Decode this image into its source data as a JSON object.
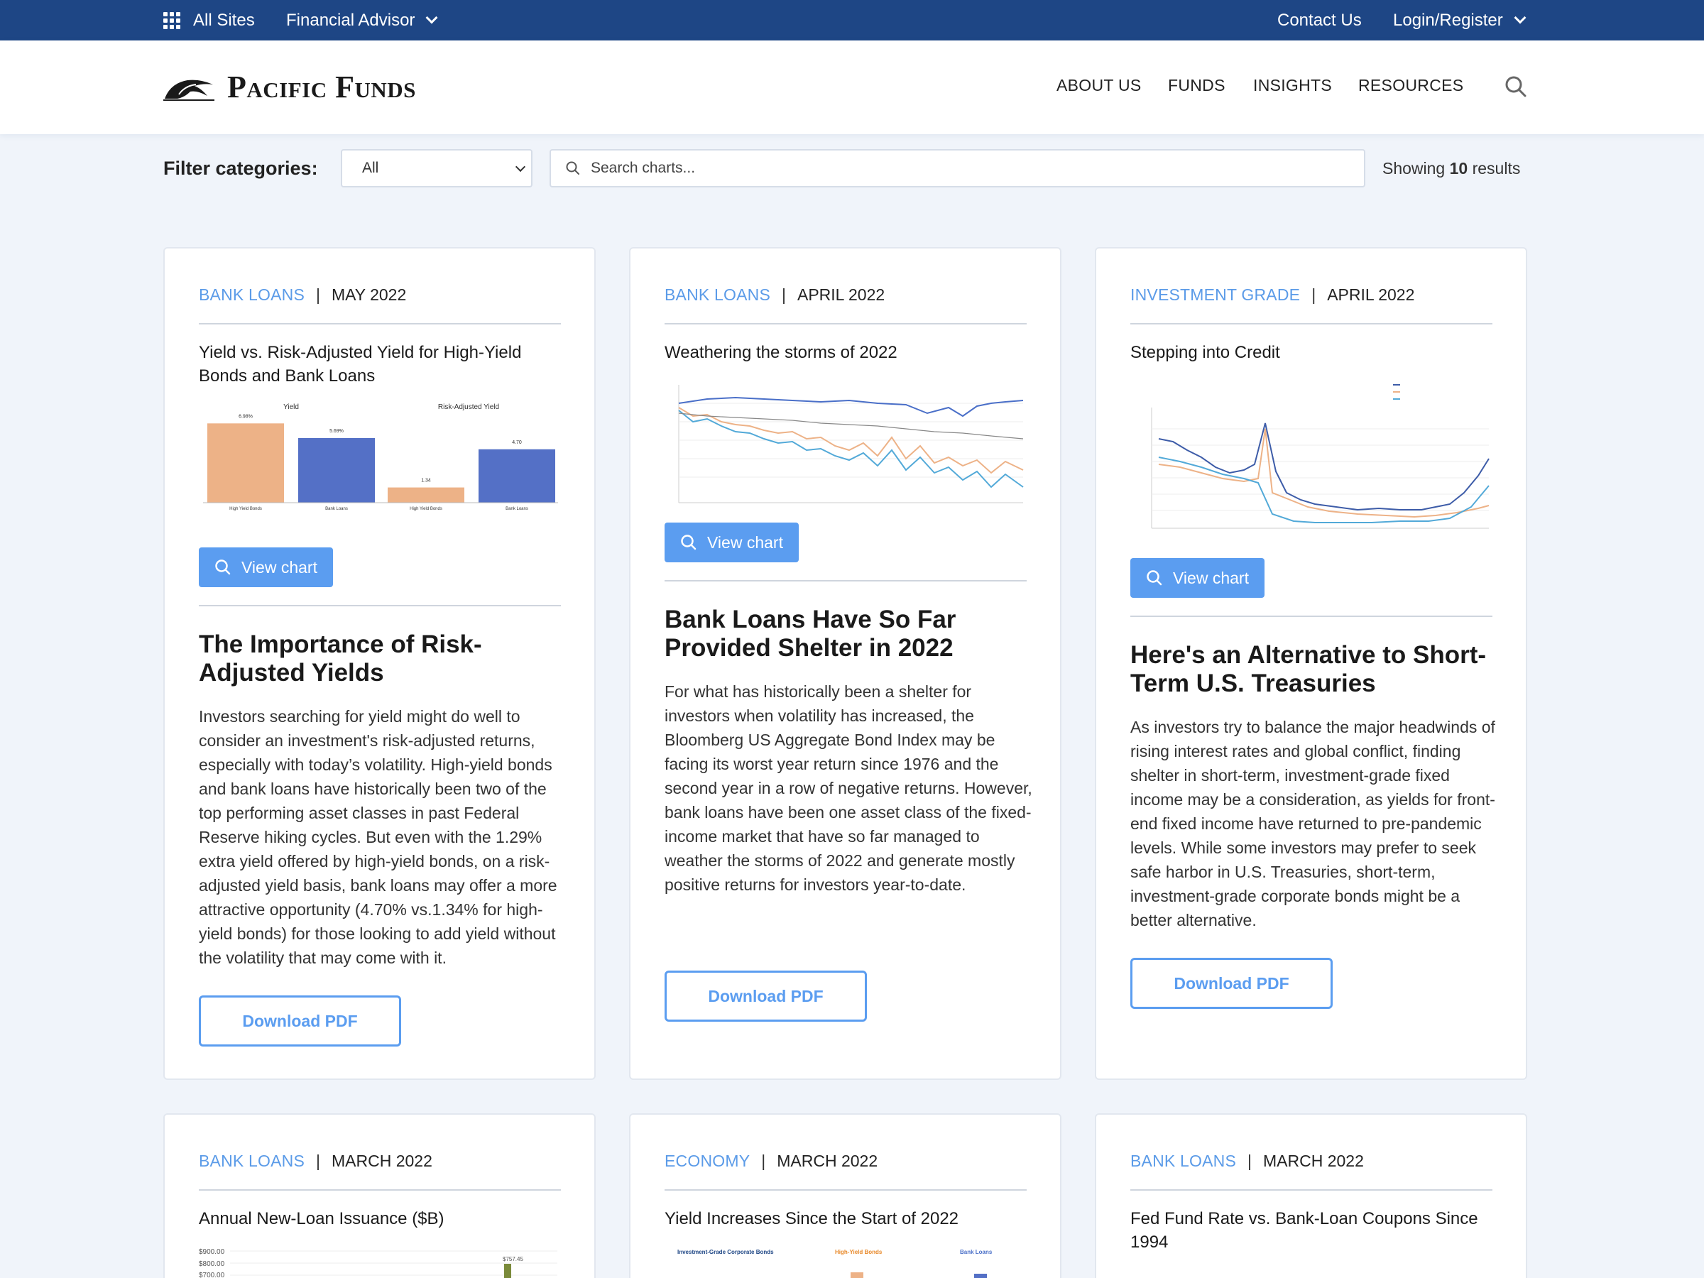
{
  "topbar": {
    "all_sites": "All Sites",
    "audience": "Financial Advisor",
    "contact": "Contact Us",
    "login": "Login/Register"
  },
  "header": {
    "logo_text": "Pacific Funds",
    "nav": [
      "ABOUT US",
      "FUNDS",
      "INSIGHTS",
      "RESOURCES"
    ]
  },
  "filter": {
    "label": "Filter categories:",
    "selected": "All",
    "search_placeholder": "Search charts...",
    "results_prefix": "Showing",
    "results_count": "10",
    "results_suffix": "results"
  },
  "cards": [
    {
      "category": "BANK LOANS",
      "date": "MAY 2022",
      "chart_title": "Yield vs. Risk-Adjusted Yield for High-Yield Bonds and Bank Loans",
      "view_label": "View chart",
      "headline": "The Importance of Risk-Adjusted Yields",
      "body": "Investors searching for yield might do well to consider an investment's risk-adjusted returns, especially with today’s volatility. High-yield bonds and bank loans have historically been two of the top performing asset classes in past Federal Reserve hiking cycles. But even with the 1.29% extra yield offered by high-yield bonds, on a risk-adjusted yield basis, bank loans may offer a more attractive opportunity (4.70% vs.1.34% for high-yield bonds) for those looking to add yield without the volatility that may come with it.",
      "pdf_label": "Download PDF"
    },
    {
      "category": "BANK LOANS",
      "date": "APRIL 2022",
      "chart_title": "Weathering the storms of 2022",
      "view_label": "View chart",
      "headline": "Bank Loans Have So Far Provided Shelter in 2022",
      "body": "For what has historically been a shelter for investors when volatility has increased, the Bloomberg US Aggregate Bond Index may be facing its worst year return since 1976 and the second year in a row of negative returns. However, bank loans have been one asset class of the fixed-income market that have so far managed to weather the storms of 2022 and generate mostly positive returns for investors year-to-date.",
      "pdf_label": "Download PDF"
    },
    {
      "category": "INVESTMENT GRADE",
      "date": "APRIL 2022",
      "chart_title": "Stepping into Credit",
      "view_label": "View chart",
      "headline": "Here's an Alternative to Short-Term U.S. Treasuries",
      "body": "As investors try to balance the major headwinds of rising interest rates and global conflict, finding shelter in short-term, investment-grade fixed income may be a consideration, as yields for front-end fixed income have returned to pre-pandemic levels. While some investors may prefer to seek safe harbor in U.S. Treasuries, short-term, investment-grade corporate bonds might be a better alternative.",
      "pdf_label": "Download PDF"
    },
    {
      "category": "BANK LOANS",
      "date": "MARCH 2022",
      "chart_title": "Annual New-Loan Issuance ($B)"
    },
    {
      "category": "ECONOMY",
      "date": "MARCH 2022",
      "chart_title": "Yield Increases Since the Start of 2022"
    },
    {
      "category": "BANK LOANS",
      "date": "MARCH 2022",
      "chart_title": "Fed Fund Rate vs. Bank-Loan Coupons Since 1994"
    }
  ],
  "thumb1": {
    "group_labels": [
      "Yield",
      "Risk-Adjusted Yield"
    ],
    "bar_labels": [
      "6.98%",
      "5.69%",
      "1.34",
      "4.70"
    ],
    "categories": [
      "High Yield Bonds",
      "Bank Loans",
      "High Yield Bonds",
      "Bank Loans"
    ],
    "values": [
      6.98,
      5.69,
      1.34,
      4.7
    ],
    "colors": [
      "#edb287",
      "#5470c6",
      "#edb287",
      "#5470c6"
    ]
  },
  "thumb4": {
    "tick_labels": [
      "$900.00",
      "$800.00",
      "$700.00"
    ],
    "bar_label": "$757.45"
  },
  "thumb5": {
    "panel_labels": [
      "Investment-Grade Corporate Bonds",
      "High-Yield Bonds",
      "Bank Loans"
    ]
  },
  "colors": {
    "topbar": "#1e4685",
    "accent": "#5b9df0",
    "category": "#5b9be8"
  }
}
